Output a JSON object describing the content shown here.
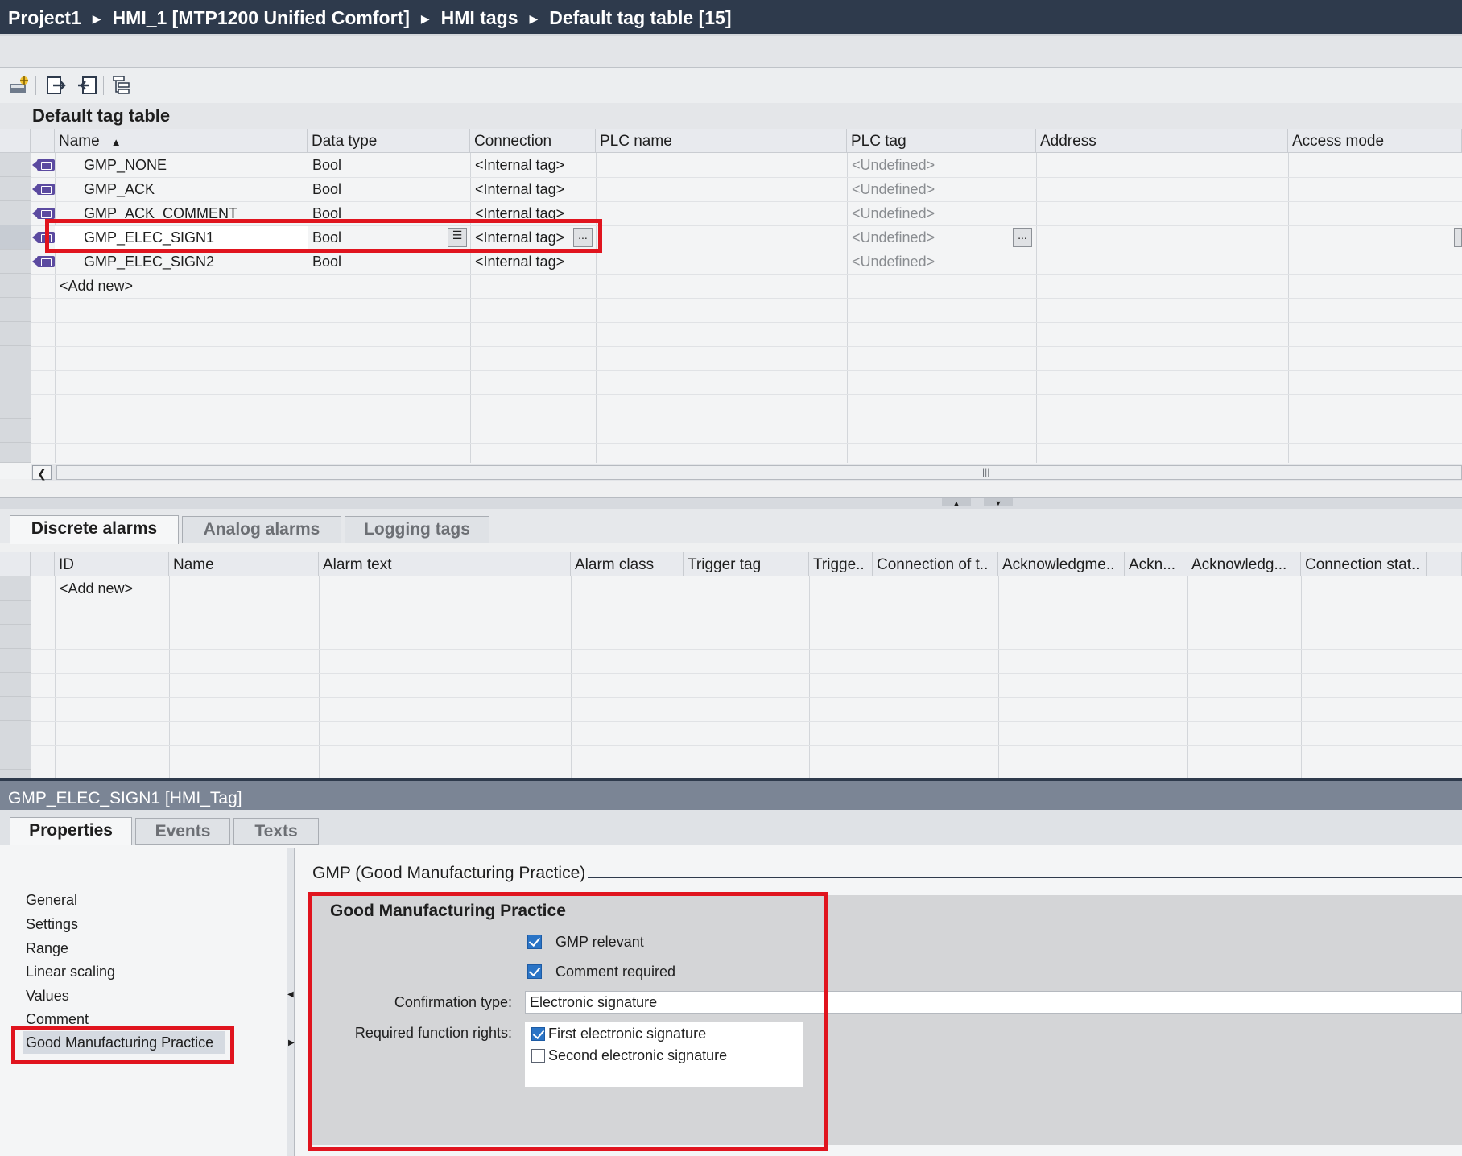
{
  "breadcrumb": [
    "Project1",
    "HMI_1 [MTP1200 Unified Comfort]",
    "HMI tags",
    "Default tag table [15]"
  ],
  "table_title": "Default tag table",
  "tag_table": {
    "columns": [
      "Name",
      "Data type",
      "Connection",
      "PLC name",
      "PLC tag",
      "Address",
      "Access mode"
    ],
    "rows": [
      {
        "name": "GMP_NONE",
        "data_type": "Bool",
        "connection": "<Internal tag>",
        "plc_tag": "<Undefined>"
      },
      {
        "name": "GMP_ACK",
        "data_type": "Bool",
        "connection": "<Internal tag>",
        "plc_tag": "<Undefined>"
      },
      {
        "name": "GMP_ACK_COMMENT",
        "data_type": "Bool",
        "connection": "<Internal tag>",
        "plc_tag": "<Undefined>"
      },
      {
        "name": "GMP_ELEC_SIGN1",
        "data_type": "Bool",
        "connection": "<Internal tag>",
        "plc_tag": "<Undefined>"
      },
      {
        "name": "GMP_ELEC_SIGN2",
        "data_type": "Bool",
        "connection": "<Internal tag>",
        "plc_tag": "<Undefined>"
      }
    ],
    "add_new": "<Add new>",
    "selected_row": "GMP_ELEC_SIGN1",
    "sort_indicator": "▲"
  },
  "lower_tabs": [
    "Discrete alarms",
    "Analog alarms",
    "Logging tags"
  ],
  "alarm_table": {
    "columns": [
      "ID",
      "Name",
      "Alarm text",
      "Alarm class",
      "Trigger tag",
      "Trigge..",
      "Connection of t..",
      "Acknowledgme..",
      "Ackn...",
      "Acknowledg...",
      "Connection stat.."
    ],
    "add_new": "<Add new>"
  },
  "properties": {
    "title": "GMP_ELEC_SIGN1 [HMI_Tag]",
    "tabs": [
      "Properties",
      "Events",
      "Texts"
    ],
    "nav_items": [
      "General",
      "Settings",
      "Range",
      "Linear scaling",
      "Values",
      "Comment",
      "Good Manufacturing Practice"
    ],
    "section_title": "GMP (Good Manufacturing Practice)",
    "group_title": "Good Manufacturing Practice",
    "gmp_relevant": {
      "label": "GMP relevant",
      "checked": true
    },
    "comment_required": {
      "label": "Comment required",
      "checked": true
    },
    "confirmation_type_label": "Confirmation type:",
    "confirmation_type_value": "Electronic signature",
    "required_rights_label": "Required function rights:",
    "rights": [
      {
        "label": "First electronic signature",
        "checked": true
      },
      {
        "label": "Second electronic signature",
        "checked": false
      }
    ]
  },
  "colors": {
    "highlight_red": "#e0141e",
    "title_bar": "#2e3a4c",
    "checkbox_blue": "#2a74c6"
  }
}
